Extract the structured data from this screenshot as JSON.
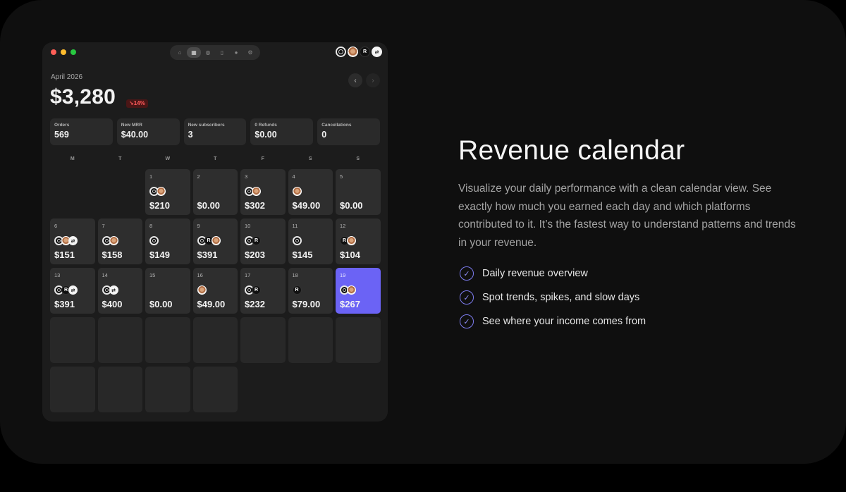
{
  "window": {
    "toolbar_icons": [
      "home-icon",
      "calendar-icon",
      "globe-icon",
      "document-icon",
      "user-icon",
      "gear-icon"
    ],
    "toolbar_active": "calendar-icon",
    "platform_icons": [
      "ring-logo",
      "avatar-face",
      "r-logo",
      "s-logo"
    ]
  },
  "header": {
    "month": "April 2026",
    "total": "$3,280",
    "change": "↘14%",
    "prev_glyph": "‹",
    "next_glyph": "›"
  },
  "stats": [
    {
      "label": "Orders",
      "value": "569"
    },
    {
      "label": "New MRR",
      "value": "$40.00"
    },
    {
      "label": "New subscribers",
      "value": "3"
    },
    {
      "label": "0 Refunds",
      "value": "$0.00"
    },
    {
      "label": "Cancellations",
      "value": "0"
    }
  ],
  "weekdays": [
    "M",
    "T",
    "W",
    "T",
    "F",
    "S",
    "S"
  ],
  "calendar": {
    "leading_blanks": 2,
    "days": [
      {
        "day": "1",
        "amount": "$210",
        "icons": [
          "ring",
          "face"
        ]
      },
      {
        "day": "2",
        "amount": "$0.00",
        "icons": []
      },
      {
        "day": "3",
        "amount": "$302",
        "icons": [
          "ring",
          "face"
        ]
      },
      {
        "day": "4",
        "amount": "$49.00",
        "icons": [
          "face"
        ]
      },
      {
        "day": "5",
        "amount": "$0.00",
        "icons": []
      },
      {
        "day": "6",
        "amount": "$151",
        "icons": [
          "ring",
          "face",
          "s"
        ]
      },
      {
        "day": "7",
        "amount": "$158",
        "icons": [
          "ring",
          "face"
        ]
      },
      {
        "day": "8",
        "amount": "$149",
        "icons": [
          "ring"
        ]
      },
      {
        "day": "9",
        "amount": "$391",
        "icons": [
          "ring",
          "r",
          "face"
        ]
      },
      {
        "day": "10",
        "amount": "$203",
        "icons": [
          "ring",
          "r"
        ]
      },
      {
        "day": "11",
        "amount": "$145",
        "icons": [
          "ring"
        ]
      },
      {
        "day": "12",
        "amount": "$104",
        "icons": [
          "r",
          "face"
        ]
      },
      {
        "day": "13",
        "amount": "$391",
        "icons": [
          "ring",
          "r",
          "s"
        ]
      },
      {
        "day": "14",
        "amount": "$400",
        "icons": [
          "ring",
          "s"
        ]
      },
      {
        "day": "15",
        "amount": "$0.00",
        "icons": []
      },
      {
        "day": "16",
        "amount": "$49.00",
        "icons": [
          "face"
        ]
      },
      {
        "day": "17",
        "amount": "$232",
        "icons": [
          "ring",
          "r"
        ]
      },
      {
        "day": "18",
        "amount": "$79.00",
        "icons": [
          "r"
        ]
      },
      {
        "day": "19",
        "amount": "$267",
        "icons": [
          "ring",
          "face"
        ],
        "today": true
      }
    ],
    "trailing_empty": 11
  },
  "feature": {
    "title": "Revenue calendar",
    "description": "Visualize your daily performance with a clean calendar view. See exactly how much you earned each day and which platforms contributed to it. It’s the fastest way to understand patterns and trends in your revenue.",
    "items": [
      "Daily revenue overview",
      "Spot trends, spikes, and slow days",
      "See where your income comes from"
    ],
    "check_glyph": "✓"
  },
  "colors": {
    "accent": "#6b63f5",
    "negative": "#ff5a5a",
    "close": "#ff5f57",
    "minimize": "#febc2e",
    "zoom": "#28c840"
  }
}
